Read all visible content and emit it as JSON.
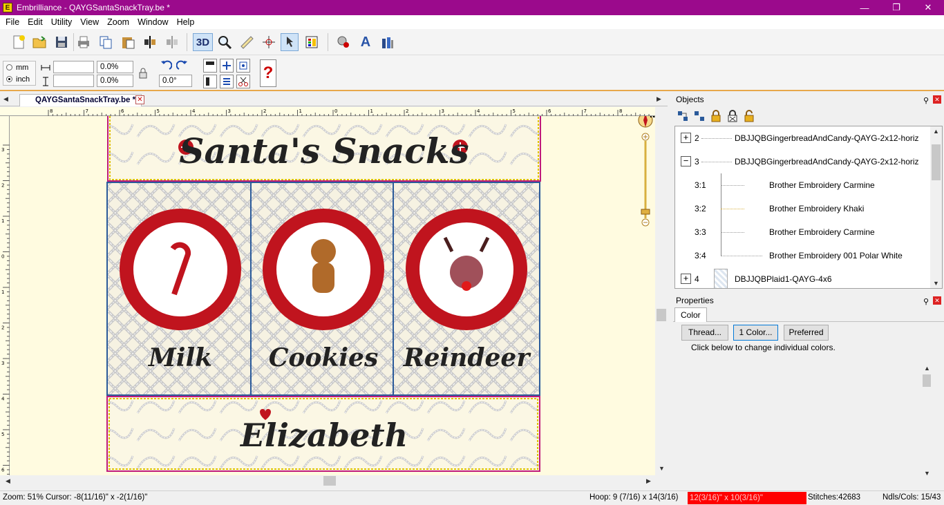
{
  "window": {
    "app_name": "Embrilliance",
    "title": "Embrilliance -  QAYGSantaSnackTray.be *",
    "controls": [
      "minimize",
      "maximize",
      "close"
    ]
  },
  "menu": [
    "File",
    "Edit",
    "Utility",
    "View",
    "Zoom",
    "Window",
    "Help"
  ],
  "toolbar": {
    "buttons": [
      "new-icon",
      "open-icon",
      "save-icon",
      "print-icon",
      "copy-icon",
      "paste-icon",
      "flip-icon",
      "mirror-icon",
      "3d-toggle",
      "zoom-icon",
      "ruler-icon",
      "center-icon",
      "select-icon",
      "color-sequence-icon",
      "stitch-icon",
      "text-icon",
      "thread-icon"
    ],
    "3d_label": "3D"
  },
  "toolbar2": {
    "unit_mm": "mm",
    "unit_inch": "inch",
    "width_value": "",
    "height_value": "",
    "width_pct": "0.0%",
    "height_pct": "0.0%",
    "rotation": "0.0°"
  },
  "document": {
    "tab_label": "QAYGSantaSnackTray.be *",
    "ruler_h_labels": [
      "8",
      "7",
      "6",
      "5",
      "4",
      "3",
      "2",
      "1",
      "0",
      "1",
      "2",
      "3",
      "4",
      "5",
      "6",
      "7",
      "8"
    ],
    "ruler_v_labels": [
      "3",
      "2",
      "1",
      "0",
      "1",
      "2",
      "3",
      "4",
      "5",
      "6"
    ],
    "design": {
      "top_title": "Santa's Snacks",
      "panels": [
        "Milk",
        "Cookies",
        "Reindeer"
      ],
      "bottom_name": "Elizabeth"
    },
    "compass_label": "N"
  },
  "objects_panel": {
    "title": "Objects",
    "rows": [
      {
        "id": "2",
        "name": "DBJJQBGingerbreadAndCandy-QAYG-2x12-horiz",
        "expander": "+"
      },
      {
        "id": "3",
        "name": "DBJJQBGingerbreadAndCandy-QAYG-2x12-horiz",
        "expander": "−"
      },
      {
        "id": "3:1",
        "name": "Brother Embroidery Carmine"
      },
      {
        "id": "3:2",
        "name": "Brother Embroidery Khaki"
      },
      {
        "id": "3:3",
        "name": "Brother Embroidery Carmine"
      },
      {
        "id": "3:4",
        "name": "Brother Embroidery 001 Polar White"
      },
      {
        "id": "4",
        "name": "DBJJQBPlaid1-QAYG-4x6",
        "expander": "+"
      }
    ]
  },
  "properties_panel": {
    "title": "Properties",
    "tab": "Color",
    "buttons": [
      "Thread...",
      "1 Color...",
      "Preferred"
    ],
    "hint": "Click below to change individual colors."
  },
  "statusbar": {
    "zoom": "Zoom: 51%",
    "cursor": "Cursor: -8(11/16)\" x -2(1/16)\"",
    "hoop": "Hoop: 9 (7/16) x 14(3/16)",
    "size": "12(3/16)\" x 10(3/16)\"",
    "stitches": "Stitches:42683",
    "ndls": "Ndls/Cols: 15/43"
  },
  "colors": {
    "titlebar": "#9b0a8c",
    "canvas_bg": "#fffbe0",
    "design_red": "#c0141e",
    "status_red": "#ff0000"
  }
}
